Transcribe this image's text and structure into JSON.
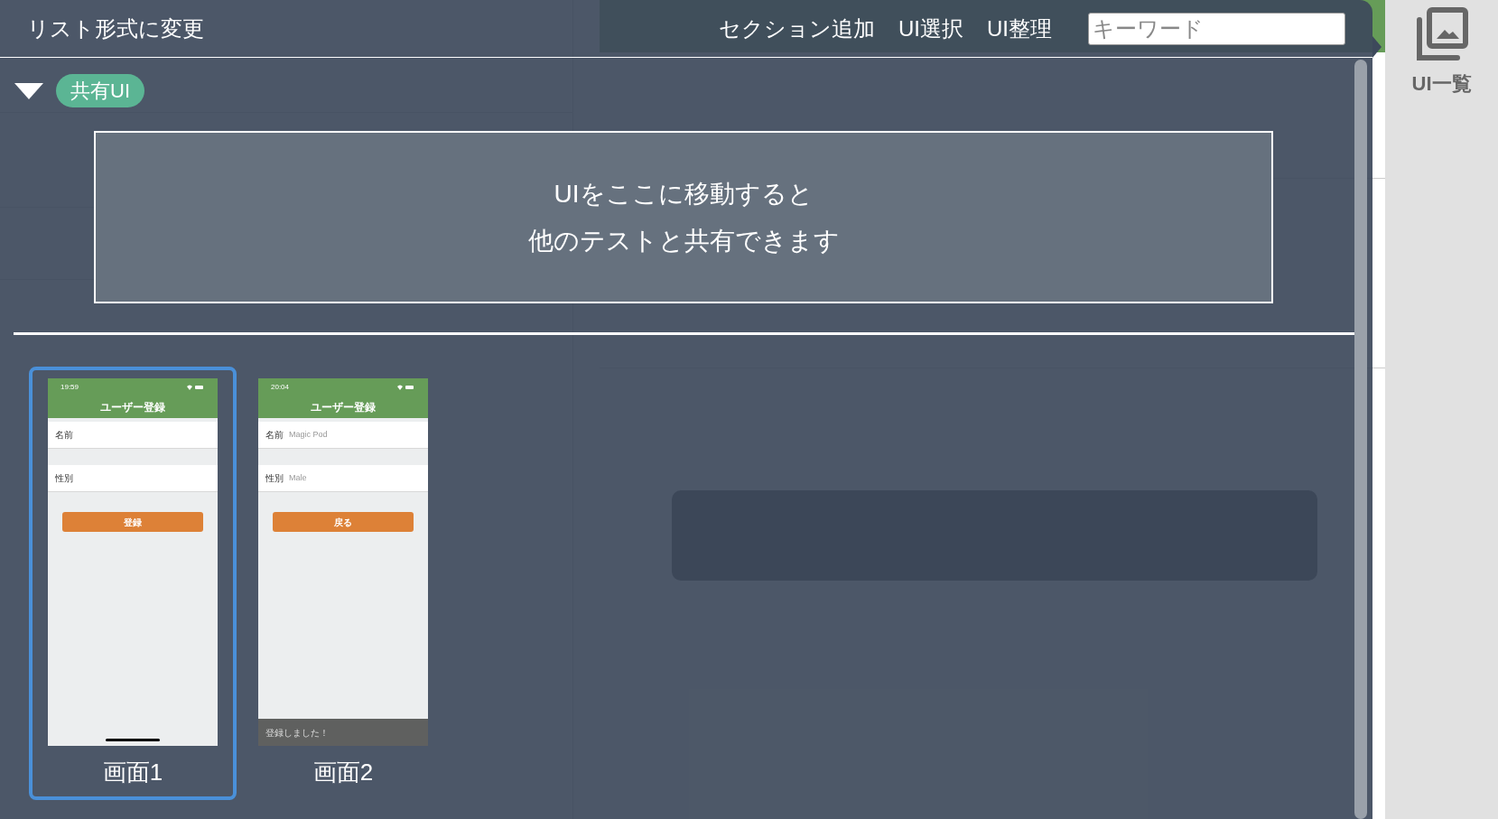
{
  "header": {
    "toggle_view": "リスト形式に変更",
    "actions": [
      "セクション追加",
      "UI選択",
      "UI整理"
    ],
    "search": {
      "placeholder": "キーワード"
    }
  },
  "section": {
    "expanded": true,
    "badge": "共有UI",
    "drop_zone_lines": [
      "UIをここに移動すると",
      "他のテストと共有できます"
    ]
  },
  "screens": [
    {
      "label": "画面1",
      "selected": true,
      "time": "19:59",
      "title": "ユーザー登録",
      "fields": [
        {
          "label": "名前"
        },
        {
          "label": "性別"
        }
      ],
      "button": "登録"
    },
    {
      "label": "画面2",
      "selected": false,
      "time": "20:04",
      "title": "ユーザー登録",
      "fields": [
        {
          "label": "名前",
          "value": "Magic Pod"
        },
        {
          "label": "性別",
          "value": "Male"
        }
      ],
      "button": "戻る",
      "toast": "登録しました！"
    }
  ],
  "sidebar": {
    "label": "UI一覧"
  }
}
